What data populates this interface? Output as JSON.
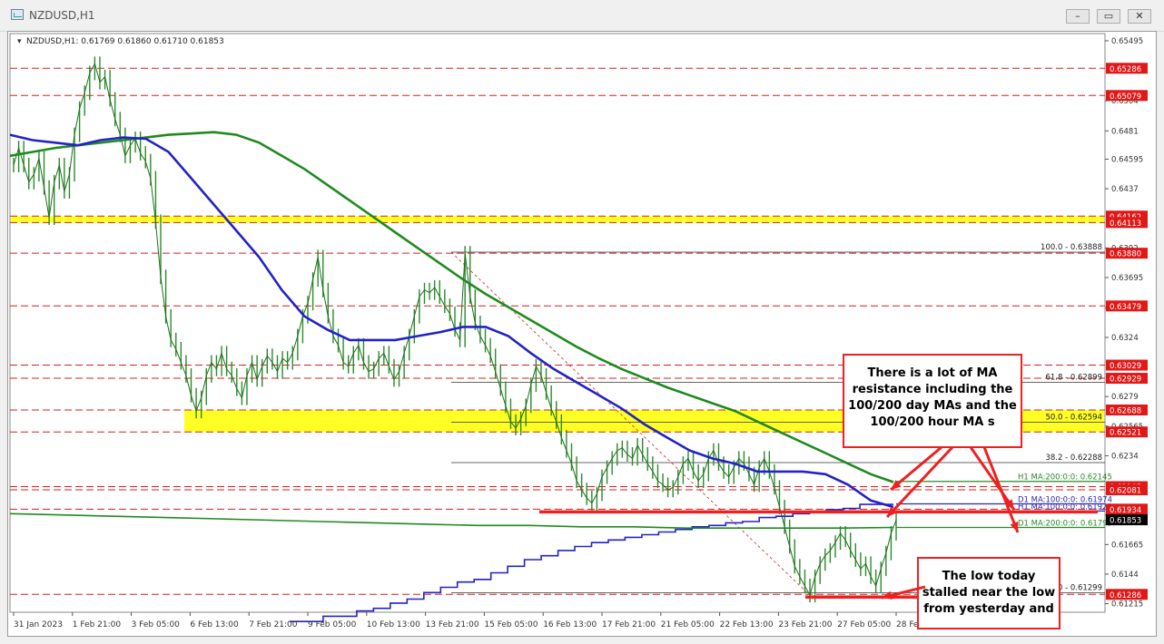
{
  "window": {
    "title": "NZDUSD,H1",
    "buttons": [
      "–",
      "▭",
      "✕"
    ]
  },
  "chart_data": {
    "type": "line",
    "symbol_header": "NZDUSD,H1:  0.61769 0.61860 0.61710 0.61853",
    "ylim": [
      0.6115,
      0.6555
    ],
    "x_ticks": [
      "31 Jan 2023",
      "1 Feb 21:00",
      "3 Feb 05:00",
      "6 Feb 13:00",
      "7 Feb 21:00",
      "9 Feb 05:00",
      "10 Feb 13:00",
      "13 Feb 21:00",
      "15 Feb 05:00",
      "16 Feb 13:00",
      "17 Feb 21:00",
      "21 Feb 05:00",
      "22 Feb 13:00",
      "23 Feb 21:00",
      "27 Feb 05:00",
      "28 Feb 1"
    ],
    "y_ticks": [
      "0.65495",
      "0.65185",
      "0.64855",
      "0.64525",
      "0.64195",
      "0.63865",
      "0.63535",
      "0.63205",
      "0.62875",
      "0.62545",
      "0.62215",
      "0.61885",
      "0.61555",
      "0.61225",
      "0.60895",
      "0.60565"
    ],
    "y_tick_values": [
      0.65495,
      0.6504,
      0.6481,
      0.64595,
      0.6437,
      0.6392,
      0.63695,
      0.63465,
      0.6324,
      0.6279,
      0.62565,
      0.6234,
      0.6189,
      0.61665,
      0.6144,
      0.61215
    ],
    "y_tick_labels": [
      "0.65495",
      "0.6504",
      "0.6481",
      "0.64595",
      "0.6437",
      "0.6392",
      "0.63695",
      "0.63465",
      "0.6324",
      "0.6279",
      "0.62565",
      "0.6234",
      "0.6189",
      "0.61665",
      "0.6144",
      "0.61215"
    ],
    "level_labels": [
      {
        "label": "0.65286",
        "value": 0.65286,
        "color": "#e01818"
      },
      {
        "label": "0.65079",
        "value": 0.65079,
        "color": "#e01818"
      },
      {
        "label": "0.64162",
        "value": 0.64162,
        "color": "#e01818"
      },
      {
        "label": "0.64113",
        "value": 0.64113,
        "color": "#e01818"
      },
      {
        "label": "0.63880",
        "value": 0.6388,
        "color": "#e01818"
      },
      {
        "label": "0.63479",
        "value": 0.63479,
        "color": "#e01818"
      },
      {
        "label": "0.63029",
        "value": 0.63029,
        "color": "#e01818"
      },
      {
        "label": "0.62929",
        "value": 0.62929,
        "color": "#e01818"
      },
      {
        "label": "0.62688",
        "value": 0.62688,
        "color": "#e01818"
      },
      {
        "label": "0.62521",
        "value": 0.62521,
        "color": "#e01818"
      },
      {
        "label": "0.62105",
        "value": 0.62105,
        "color": "#e01818"
      },
      {
        "label": "0.62081",
        "value": 0.62081,
        "color": "#e01818"
      },
      {
        "label": "0.61934",
        "value": 0.61934,
        "color": "#e01818"
      },
      {
        "label": "0.61853",
        "value": 0.61853,
        "color": "#000000"
      },
      {
        "label": "0.61286",
        "value": 0.61286,
        "color": "#e01818"
      }
    ],
    "fib_levels": [
      {
        "label": "100.0 - 0.63888",
        "value": 0.63888
      },
      {
        "label": "61.8 - 0.62899",
        "value": 0.62899
      },
      {
        "label": "50.0 - 0.62594",
        "value": 0.62594
      },
      {
        "label": "38.2 - 0.62288",
        "value": 0.62288
      },
      {
        "label": "0.0 - 0.61299",
        "value": 0.61299
      }
    ],
    "ma_labels": [
      {
        "label": "H1 MA:200:0:0: 0.62145",
        "value": 0.62145,
        "color": "#2a8a2a"
      },
      {
        "label": "D1 MA:100:0:0: 0.61974",
        "value": 0.61974,
        "color": "#2a2aa8"
      },
      {
        "label": "H1 MA:100:0:0: 0.61920",
        "value": 0.6192,
        "color": "#2a2aa8"
      },
      {
        "label": "D1 MA:200:0:0: 0.61795",
        "value": 0.61795,
        "color": "#2a8a2a"
      }
    ],
    "zones": [
      {
        "from": 0.64113,
        "to": 0.64162,
        "color": "#ffff00"
      },
      {
        "from": 0.62521,
        "to": 0.62688,
        "color": "#ffff00"
      }
    ],
    "price": [
      0.6455,
      0.6468,
      0.6455,
      0.6442,
      0.6448,
      0.646,
      0.6438,
      0.6415,
      0.6442,
      0.6455,
      0.6435,
      0.6448,
      0.6478,
      0.6498,
      0.651,
      0.6525,
      0.6532,
      0.6518,
      0.6522,
      0.6505,
      0.649,
      0.6478,
      0.6462,
      0.647,
      0.6475,
      0.6464,
      0.6458,
      0.6445,
      0.6412,
      0.637,
      0.634,
      0.6322,
      0.6315,
      0.6305,
      0.6295,
      0.628,
      0.6268,
      0.6278,
      0.6295,
      0.6305,
      0.63,
      0.6312,
      0.63,
      0.6295,
      0.6285,
      0.6278,
      0.6295,
      0.6305,
      0.6292,
      0.6302,
      0.631,
      0.6305,
      0.6298,
      0.6308,
      0.6305,
      0.6312,
      0.6325,
      0.634,
      0.635,
      0.6368,
      0.6385,
      0.636,
      0.634,
      0.6325,
      0.6318,
      0.6305,
      0.6302,
      0.6312,
      0.6318,
      0.6305,
      0.6298,
      0.63,
      0.6308,
      0.6312,
      0.6302,
      0.6292,
      0.6298,
      0.6312,
      0.6325,
      0.634,
      0.6355,
      0.636,
      0.6358,
      0.6362,
      0.6355,
      0.6348,
      0.6342,
      0.633,
      0.6322,
      0.6388,
      0.6355,
      0.6335,
      0.6325,
      0.6318,
      0.631,
      0.6298,
      0.6285,
      0.6272,
      0.626,
      0.6255,
      0.6262,
      0.6272,
      0.6288,
      0.6302,
      0.6295,
      0.6282,
      0.627,
      0.626,
      0.6248,
      0.6238,
      0.6228,
      0.6215,
      0.6208,
      0.6202,
      0.6198,
      0.6205,
      0.6218,
      0.6225,
      0.6232,
      0.6238,
      0.624,
      0.6235,
      0.6232,
      0.6242,
      0.6235,
      0.6228,
      0.6222,
      0.6215,
      0.6212,
      0.6208,
      0.621,
      0.6218,
      0.6228,
      0.6232,
      0.6222,
      0.6215,
      0.622,
      0.6232,
      0.6238,
      0.6228,
      0.6222,
      0.6218,
      0.6225,
      0.6232,
      0.6228,
      0.622,
      0.6212,
      0.6225,
      0.6232,
      0.6222,
      0.621,
      0.6195,
      0.618,
      0.6165,
      0.615,
      0.6142,
      0.6135,
      0.6128,
      0.6142,
      0.6152,
      0.6158,
      0.6162,
      0.6168,
      0.6175,
      0.617,
      0.6162,
      0.6155,
      0.6148,
      0.6152,
      0.6142,
      0.6135,
      0.6148,
      0.616,
      0.6175,
      0.6185
    ],
    "ma_green": [
      0.6462,
      0.6465,
      0.6468,
      0.647,
      0.6472,
      0.6474,
      0.6476,
      0.6478,
      0.6479,
      0.648,
      0.6478,
      0.6472,
      0.6462,
      0.6452,
      0.644,
      0.6428,
      0.6416,
      0.6404,
      0.6392,
      0.638,
      0.6368,
      0.6357,
      0.6347,
      0.6337,
      0.6327,
      0.6317,
      0.6308,
      0.63,
      0.6293,
      0.6286,
      0.628,
      0.6274,
      0.6268,
      0.626,
      0.6252,
      0.6244,
      0.6236,
      0.6228,
      0.622,
      0.6214
    ],
    "ma_blue": [
      0.6478,
      0.6474,
      0.6472,
      0.647,
      0.6474,
      0.6476,
      0.6475,
      0.6465,
      0.6445,
      0.6425,
      0.6405,
      0.6385,
      0.636,
      0.634,
      0.633,
      0.6322,
      0.6322,
      0.6322,
      0.6325,
      0.6328,
      0.6332,
      0.6332,
      0.6325,
      0.6312,
      0.63,
      0.629,
      0.628,
      0.627,
      0.6258,
      0.6248,
      0.6238,
      0.6232,
      0.6228,
      0.6222,
      0.6222,
      0.6222,
      0.622,
      0.6212,
      0.62,
      0.6195
    ],
    "d1_ma100": [
      0.6108,
      0.6108,
      0.6112,
      0.6112,
      0.6116,
      0.6118,
      0.6122,
      0.6125,
      0.613,
      0.6134,
      0.6138,
      0.614,
      0.6145,
      0.615,
      0.6155,
      0.6158,
      0.6162,
      0.6165,
      0.6168,
      0.617,
      0.6172,
      0.6174,
      0.6176,
      0.6178,
      0.618,
      0.6181,
      0.6183,
      0.6184,
      0.6187,
      0.6188,
      0.619,
      0.6191,
      0.6193,
      0.6194,
      0.6197,
      0.6197
    ],
    "d1_ma200": [
      0.619,
      0.6189,
      0.6188,
      0.6187,
      0.6186,
      0.6185,
      0.6184,
      0.6183,
      0.6182,
      0.6181,
      0.6181,
      0.618,
      0.618,
      0.6179,
      0.6179,
      0.6179,
      0.6179,
      0.61795
    ],
    "annotations": [
      {
        "text": "There is a lot of MA resistance including the 100/200 day MAs and the 100/200 hour MA s"
      },
      {
        "text": "The low today stalled near the low from yesterday and"
      }
    ]
  }
}
